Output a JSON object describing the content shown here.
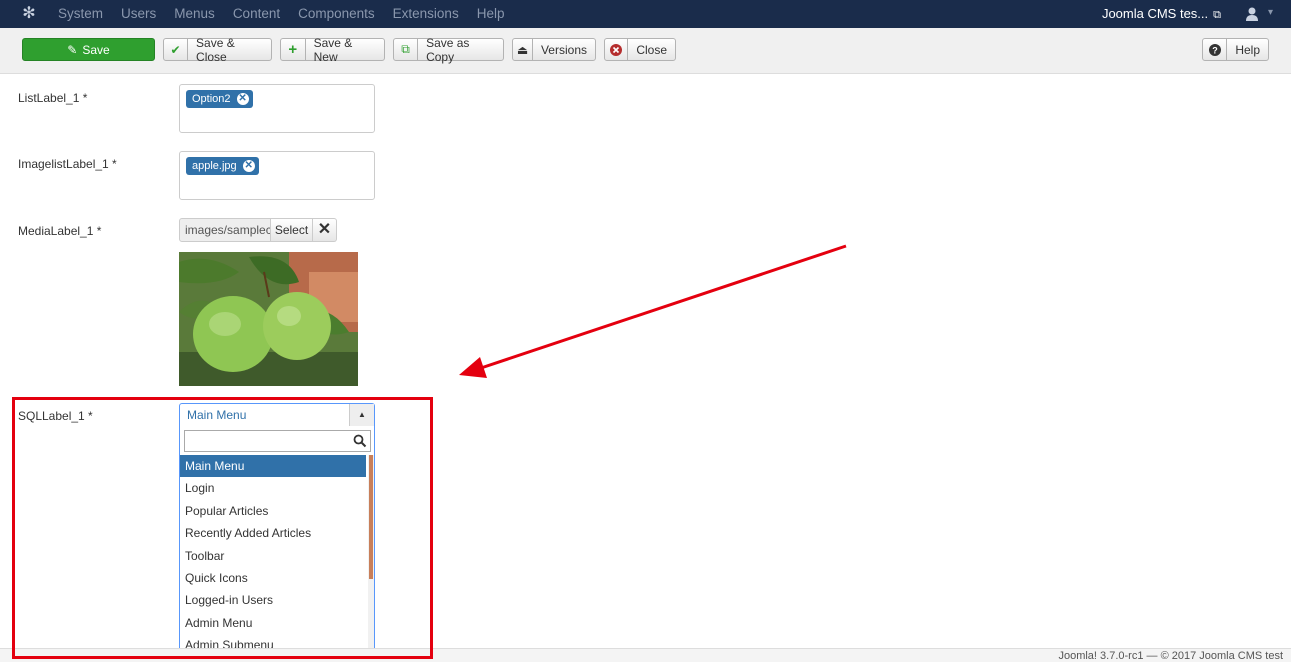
{
  "topnav": {
    "menu": [
      "System",
      "Users",
      "Menus",
      "Content",
      "Components",
      "Extensions",
      "Help"
    ],
    "site_name": "Joomla CMS tes..."
  },
  "toolbar": {
    "save": "Save",
    "save_close": "Save & Close",
    "save_new": "Save & New",
    "save_copy": "Save as Copy",
    "versions": "Versions",
    "close": "Close",
    "help": "Help"
  },
  "form": {
    "list_label": "ListLabel_1 *",
    "list_tag": "Option2",
    "imagelist_label": "ImagelistLabel_1 *",
    "imagelist_tag": "apple.jpg",
    "media_label": "MediaLabel_1 *",
    "media_path": "images/samplec",
    "media_select": "Select",
    "sql_label": "SQLLabel_1 *",
    "sql_value": "Main Menu",
    "sql_options": [
      "Main Menu",
      "Login",
      "Popular Articles",
      "Recently Added Articles",
      "Toolbar",
      "Quick Icons",
      "Logged-in Users",
      "Admin Menu",
      "Admin Submenu"
    ]
  },
  "footer": {
    "version": "Joomla! 3.7.0-rc1  —  © 2017 Joomla CMS test"
  },
  "colors": {
    "nav_bg": "#1a2c4b",
    "save_green": "#2f9f2f",
    "highlight_red": "#e4000f",
    "tag_blue": "#3071a9"
  }
}
